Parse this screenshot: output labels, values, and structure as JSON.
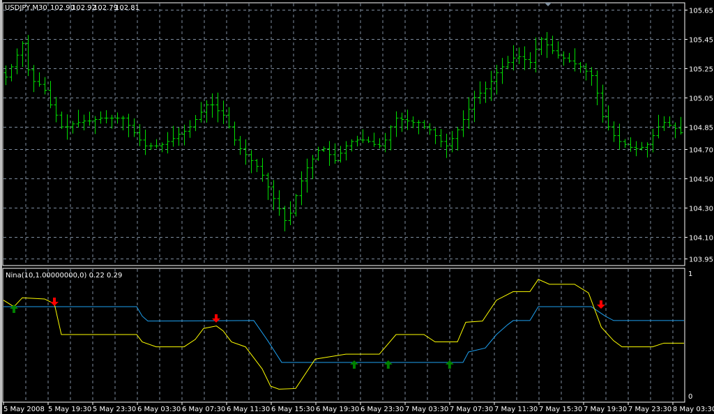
{
  "header": {
    "symbol": "USDJPY,M30",
    "open": "102.90",
    "high": "102.92",
    "low": "102.79",
    "close": "102.81"
  },
  "indicator": {
    "label": "Nina(10,1.00000000,0) 0.22 0.29",
    "scale_max": "1",
    "scale_min": "0"
  },
  "colors": {
    "background": "#000000",
    "bars": "#00e000",
    "grid": "#7f8ea0",
    "signal_line": "#1ea0f0",
    "main_line": "#ffff00",
    "arrow_up": "#008000",
    "arrow_down": "#ff0000"
  },
  "chart_data": [
    {
      "type": "ohlc",
      "title": "USDJPY,M30",
      "timeframe_minutes": 30,
      "ylim": [
        103.95,
        105.65
      ],
      "y_ticks": [
        "105.65",
        "105.45",
        "105.25",
        "105.05",
        "104.85",
        "104.70",
        "104.50",
        "104.30",
        "104.10",
        "103.95"
      ],
      "x_ticks": [
        "5 May 2008",
        "5 May 19:30",
        "5 May 23:30",
        "6 May 03:30",
        "6 May 07:30",
        "6 May 11:30",
        "6 May 15:30",
        "6 May 19:30",
        "6 May 23:30",
        "7 May 03:30",
        "7 May 07:30",
        "7 May 11:30",
        "7 May 15:30",
        "7 May 19:30",
        "7 May 23:30",
        "8 May 03:30"
      ],
      "grid": true,
      "closes": [
        105.19,
        105.26,
        105.34,
        105.42,
        105.24,
        105.16,
        105.14,
        105.1,
        105.0,
        104.93,
        104.85,
        104.85,
        104.87,
        104.88,
        104.89,
        104.89,
        104.9,
        104.91,
        104.91,
        104.91,
        104.91,
        104.91,
        104.86,
        104.81,
        104.76,
        104.72,
        104.72,
        104.72,
        104.73,
        104.75,
        104.77,
        104.8,
        104.82,
        104.85,
        104.9,
        104.95,
        105.0,
        105.0,
        104.96,
        104.93,
        104.85,
        104.76,
        104.7,
        104.66,
        104.62,
        104.58,
        104.52,
        104.44,
        104.36,
        104.29,
        104.21,
        104.26,
        104.38,
        104.48,
        104.57,
        104.63,
        104.69,
        104.7,
        104.66,
        104.62,
        104.67,
        104.72,
        104.75,
        104.76,
        104.76,
        104.75,
        104.73,
        104.72,
        104.76,
        104.85,
        104.91,
        104.9,
        104.89,
        104.88,
        104.88,
        104.85,
        104.83,
        104.79,
        104.75,
        104.72,
        104.77,
        104.83,
        104.9,
        104.97,
        105.05,
        105.08,
        105.11,
        105.16,
        105.22,
        105.26,
        105.29,
        105.32,
        105.33,
        105.31,
        105.29,
        105.38,
        105.45,
        105.41,
        105.37,
        105.34,
        105.32,
        105.3,
        105.28,
        105.26,
        105.23,
        105.2,
        105.08,
        104.92,
        104.85,
        104.79,
        104.75,
        104.73,
        104.71,
        104.7,
        104.71,
        104.73,
        104.79,
        104.85,
        104.88,
        104.86,
        104.84,
        104.81
      ]
    },
    {
      "type": "line",
      "title": "Nina(10,1.00000000,0) 0.22 0.29",
      "ylim": [
        0,
        1
      ],
      "series": [
        {
          "name": "signal",
          "color": "#1ea0f0",
          "points": [
            [
              -1,
              0.727
            ],
            [
              23.5,
              0.727
            ],
            [
              24.5,
              0.65
            ],
            [
              25.5,
              0.61
            ],
            [
              44.5,
              0.614
            ],
            [
              47,
              0.45
            ],
            [
              49.5,
              0.273
            ],
            [
              82,
              0.273
            ],
            [
              83,
              0.358
            ],
            [
              86,
              0.39
            ],
            [
              88,
              0.5
            ],
            [
              90,
              0.58
            ],
            [
              91,
              0.614
            ],
            [
              94,
              0.614
            ],
            [
              95.5,
              0.727
            ],
            [
              105,
              0.727
            ],
            [
              107.5,
              0.65
            ],
            [
              109,
              0.614
            ],
            [
              122,
              0.614
            ]
          ]
        },
        {
          "name": "main",
          "color": "#ffff00",
          "points": [
            [
              -1,
              0.78
            ],
            [
              1.5,
              0.727
            ],
            [
              3,
              0.8
            ],
            [
              7,
              0.79
            ],
            [
              8.75,
              0.75
            ],
            [
              10,
              0.5
            ],
            [
              23.5,
              0.5
            ],
            [
              24.5,
              0.44
            ],
            [
              27,
              0.4
            ],
            [
              32,
              0.4
            ],
            [
              34,
              0.46
            ],
            [
              35.5,
              0.55
            ],
            [
              37.8,
              0.57
            ],
            [
              39,
              0.53
            ],
            [
              40.5,
              0.44
            ],
            [
              43,
              0.4
            ],
            [
              46,
              0.22
            ],
            [
              47.5,
              0.08
            ],
            [
              49,
              0.055
            ],
            [
              52,
              0.06
            ],
            [
              55.5,
              0.3
            ],
            [
              61,
              0.34
            ],
            [
              67,
              0.34
            ],
            [
              70,
              0.5
            ],
            [
              75,
              0.5
            ],
            [
              77,
              0.44
            ],
            [
              81,
              0.44
            ],
            [
              82.5,
              0.6
            ],
            [
              85.5,
              0.61
            ],
            [
              88,
              0.78
            ],
            [
              91,
              0.85
            ],
            [
              94,
              0.85
            ],
            [
              95.5,
              0.95
            ],
            [
              97.5,
              0.91
            ],
            [
              102,
              0.91
            ],
            [
              104.5,
              0.84
            ],
            [
              106.8,
              0.56
            ],
            [
              109,
              0.45
            ],
            [
              110.5,
              0.4
            ],
            [
              116,
              0.4
            ],
            [
              118,
              0.43
            ],
            [
              122,
              0.43
            ]
          ]
        }
      ],
      "arrows": [
        {
          "type": "up",
          "bar": 1.5,
          "value": 0.727
        },
        {
          "type": "down",
          "bar": 8.75,
          "value": 0.75
        },
        {
          "type": "down",
          "bar": 37.75,
          "value": 0.614
        },
        {
          "type": "up",
          "bar": 62.5,
          "value": 0.273
        },
        {
          "type": "up",
          "bar": 68.6,
          "value": 0.273
        },
        {
          "type": "up",
          "bar": 79.6,
          "value": 0.273
        },
        {
          "type": "down",
          "bar": 106.75,
          "value": 0.727
        }
      ]
    }
  ]
}
